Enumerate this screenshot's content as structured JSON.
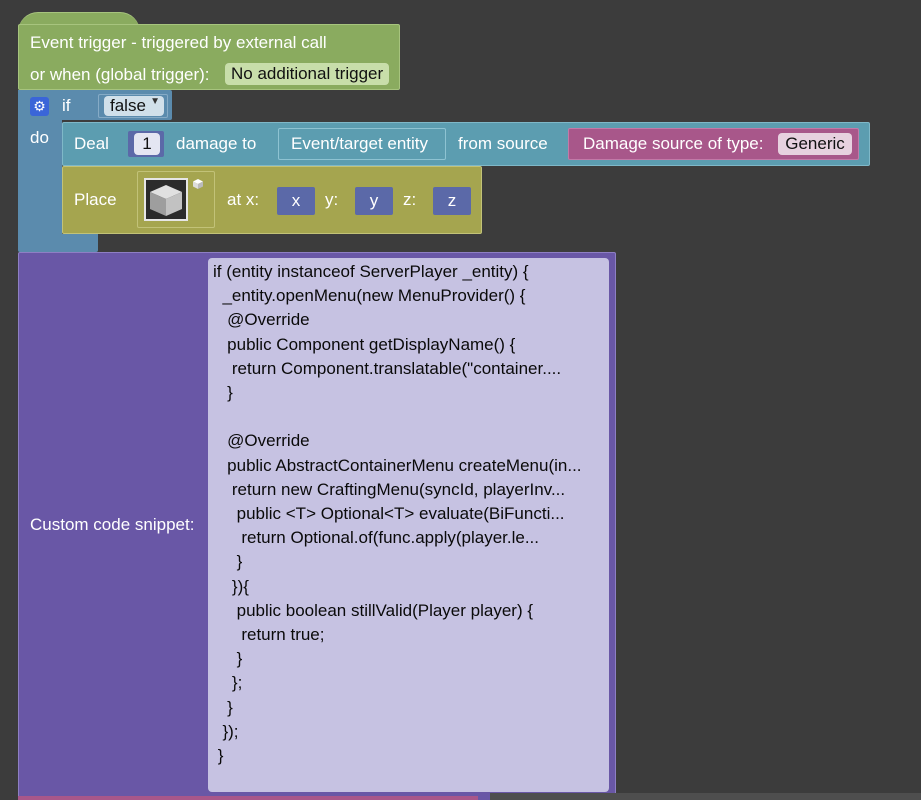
{
  "event_trigger": {
    "title": "Event trigger - triggered by external call",
    "global_label": "or when (global trigger):",
    "global_value": "No additional trigger"
  },
  "if_block": {
    "if_label": "if",
    "condition": "false",
    "do_label": "do"
  },
  "deal_block": {
    "deal_label": "Deal",
    "amount": "1",
    "damage_to_label": "damage to",
    "target": "Event/target entity",
    "from_source_label": "from source",
    "source_label": "Damage source of type:",
    "source_type": "Generic"
  },
  "place_block": {
    "place_label": "Place",
    "at_x_label": "at x:",
    "x_value": "x",
    "y_label": "y:",
    "y_value": "y",
    "z_label": "z:",
    "z_value": "z"
  },
  "code_block": {
    "label": "Custom code snippet:",
    "lines": [
      "if (entity instanceof ServerPlayer _entity) {",
      "  _entity.openMenu(new MenuProvider() {",
      "   @Override",
      "   public Component getDisplayName() {",
      "    return Component.translatable(\"container....",
      "   }",
      "",
      "   @Override",
      "   public AbstractContainerMenu createMenu(in...",
      "    return new CraftingMenu(syncId, playerInv...",
      "     public <T> Optional<T> evaluate(BiFuncti...",
      "      return Optional.of(func.apply(player.le...",
      "     }",
      "    }){",
      "     public boolean stillValid(Player player) {",
      "      return true;",
      "     }",
      "    };",
      "   }",
      "  });",
      " }"
    ]
  },
  "colors": {
    "event": "#8aab5f",
    "logic": "#5b8bad",
    "action": "#5c9db0",
    "damage_source": "#a8578a",
    "world": "#a5a54f",
    "math": "#5b69a8",
    "advanced": "#6957a6",
    "workspace": "#3c3c3c"
  },
  "icons": {
    "mutator": "gear-icon",
    "item_picker": "cube-icon"
  }
}
